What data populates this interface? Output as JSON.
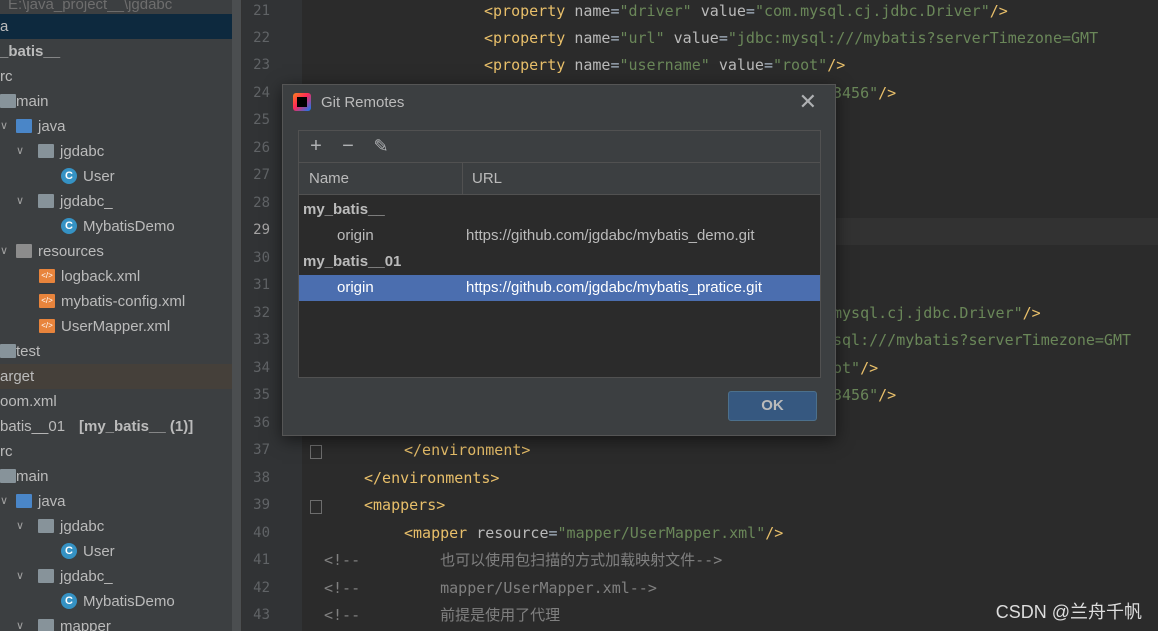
{
  "project_tree": {
    "rows": [
      {
        "label": "E:\\java_project__\\jgdabc"
      },
      {
        "label": "a"
      },
      {
        "label": "_batis__"
      },
      {
        "label": "rc"
      },
      {
        "label": "main"
      },
      {
        "label": "java"
      },
      {
        "label": "jgdabc"
      },
      {
        "label": "User"
      },
      {
        "label": "jgdabc_"
      },
      {
        "label": "MybatisDemo"
      },
      {
        "label": "resources"
      },
      {
        "label": "logback.xml"
      },
      {
        "label": "mybatis-config.xml"
      },
      {
        "label": "UserMapper.xml"
      },
      {
        "label": "test"
      },
      {
        "label": "arget"
      },
      {
        "label": "oom.xml"
      },
      {
        "label": "batis__01",
        "suffix": "[my_batis__ (1)]"
      },
      {
        "label": "rc"
      },
      {
        "label": "main"
      },
      {
        "label": "java"
      },
      {
        "label": "jgdabc"
      },
      {
        "label": "User"
      },
      {
        "label": "jgdabc_"
      },
      {
        "label": "MybatisDemo"
      },
      {
        "label": "mapper"
      }
    ]
  },
  "editor": {
    "line_numbers": [
      "21",
      "22",
      "23",
      "24",
      "25",
      "26",
      "27",
      "28",
      "29",
      "30",
      "31",
      "32",
      "33",
      "34",
      "35",
      "36",
      "37",
      "38",
      "39",
      "40",
      "41",
      "42",
      "43"
    ],
    "current_line": "29",
    "lines": {
      "l21": {
        "tag_open": "<property",
        "a1": "name",
        "v1": "\"driver\"",
        "a2": "value",
        "v2": "\"com.mysql.cj.jdbc.Driver\"",
        "close": "/>"
      },
      "l22": {
        "tag_open": "<property",
        "a1": "name",
        "v1": "\"url\"",
        "a2": "value",
        "v2": "\"jdbc:mysql:///mybatis?serverTimezone=GMT"
      },
      "l23": {
        "tag_open": "<property",
        "a1": "name",
        "v1": "\"username\"",
        "a2": "value",
        "v2": "\"root\"",
        "close": "/>"
      },
      "l24": {
        "v": "3456\"",
        "close": "/>"
      },
      "l32": {
        "v": "mysql.cj.jdbc.Driver\"",
        "close": "/>"
      },
      "l33": {
        "v": "sql:///mybatis?serverTimezone=GMT"
      },
      "l34": {
        "v": "ot\"",
        "close": "/>"
      },
      "l35": {
        "v": "3456\"",
        "close": "/>"
      },
      "l37": {
        "text": "</environment>"
      },
      "l38": {
        "text": "</environments>"
      },
      "l39": {
        "text": "<mappers>"
      },
      "l40": {
        "tag_open": "<mapper",
        "a1": "resource",
        "v1": "\"mapper/UserMapper.xml\"",
        "close": "/>"
      },
      "l41": {
        "cmt": "<!--",
        "text": "也可以使用包扫描的方式加载映射文件-->"
      },
      "l42": {
        "cmt": "<!--",
        "text": "mapper/UserMapper.xml-->"
      },
      "l43": {
        "cmt": "<!--",
        "text": "前提是使用了代理"
      }
    }
  },
  "dialog": {
    "title": "Git Remotes",
    "toolbar": {
      "add": "+",
      "remove": "−",
      "edit": "✎"
    },
    "columns": {
      "name": "Name",
      "url": "URL"
    },
    "groups": [
      {
        "name": "my_batis__",
        "remotes": [
          {
            "name": "origin",
            "url": "https://github.com/jgdabc/mybatis_demo.git"
          }
        ]
      },
      {
        "name": "my_batis__01",
        "remotes": [
          {
            "name": "origin",
            "url": "https://github.com/jgdabc/mybatis_pratice.git"
          }
        ]
      }
    ],
    "ok_label": "OK",
    "close_glyph": "✕"
  },
  "watermark": "CSDN @兰舟千帆",
  "colors": {
    "accent": "#4b6eaf",
    "ok_button": "#365880",
    "xml_tag": "#e8bf6a",
    "xml_value": "#6a8759"
  }
}
